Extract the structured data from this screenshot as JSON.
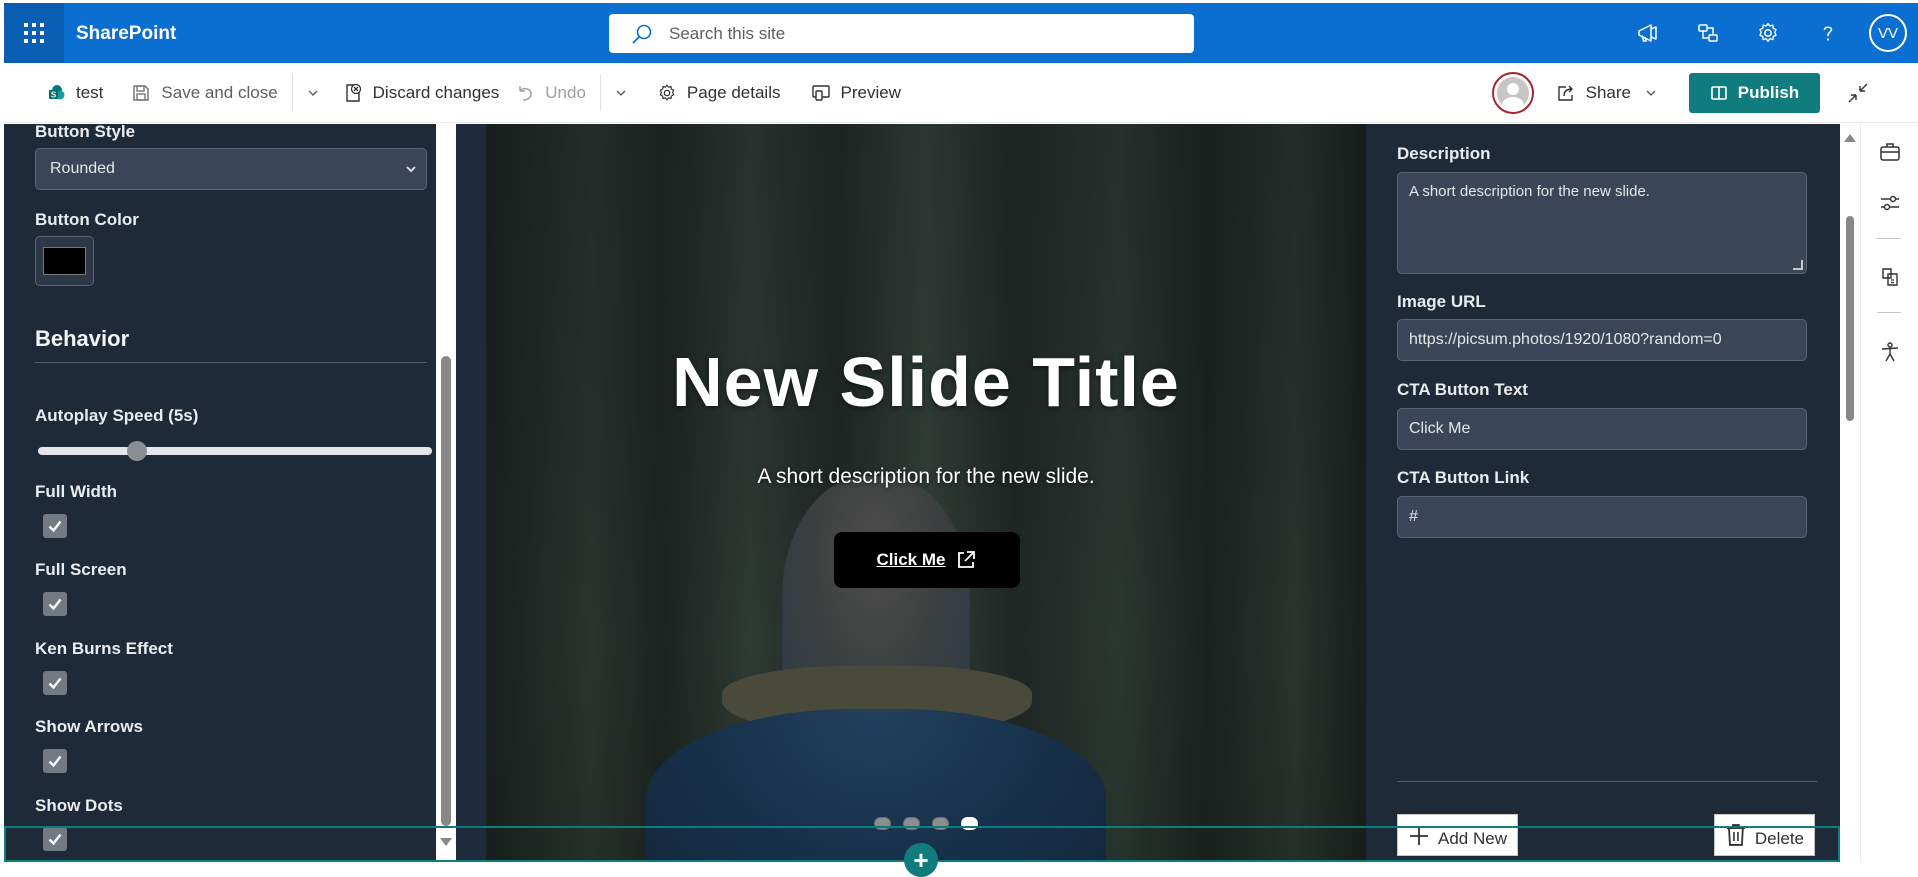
{
  "suite": {
    "app_name": "SharePoint",
    "search_placeholder": "Search this site",
    "user_initials": "VV",
    "icons": [
      "megaphone-icon",
      "share-people-icon",
      "gear-icon",
      "help-icon"
    ]
  },
  "command_bar": {
    "page_name": "test",
    "save_and_close": "Save and close",
    "discard_changes": "Discard changes",
    "undo": "Undo",
    "page_details": "Page details",
    "preview": "Preview",
    "share": "Share",
    "publish": "Publish"
  },
  "left_panel": {
    "button_style_label": "Button Style",
    "button_style_value": "Rounded",
    "button_color_label": "Button Color",
    "button_color_value": "#000000",
    "behavior_heading": "Behavior",
    "autoplay_label": "Autoplay Speed (5s)",
    "autoplay_fraction": 0.25,
    "checkboxes": [
      {
        "label": "Full Width",
        "checked": true
      },
      {
        "label": "Full Screen",
        "checked": true
      },
      {
        "label": "Ken Burns Effect",
        "checked": true
      },
      {
        "label": "Show Arrows",
        "checked": true
      },
      {
        "label": "Show Dots",
        "checked": true
      }
    ]
  },
  "slide": {
    "title": "New Slide Title",
    "description": "A short description for the new slide.",
    "cta_text": "Click Me",
    "dots_count": 4,
    "active_dot": 3
  },
  "right_panel": {
    "description_label": "Description",
    "description_value": "A short description for the new slide.",
    "image_url_label": "Image URL",
    "image_url_value": "https://picsum.photos/1920/1080?random=0",
    "cta_text_label": "CTA Button Text",
    "cta_text_value": "Click Me",
    "cta_link_label": "CTA Button Link",
    "cta_link_value": "#",
    "add_new": "Add New",
    "delete": "Delete"
  },
  "colors": {
    "suite_blue": "#0b6ed1",
    "publish_teal": "#117c7e",
    "panel_bg": "#1f2a38"
  }
}
